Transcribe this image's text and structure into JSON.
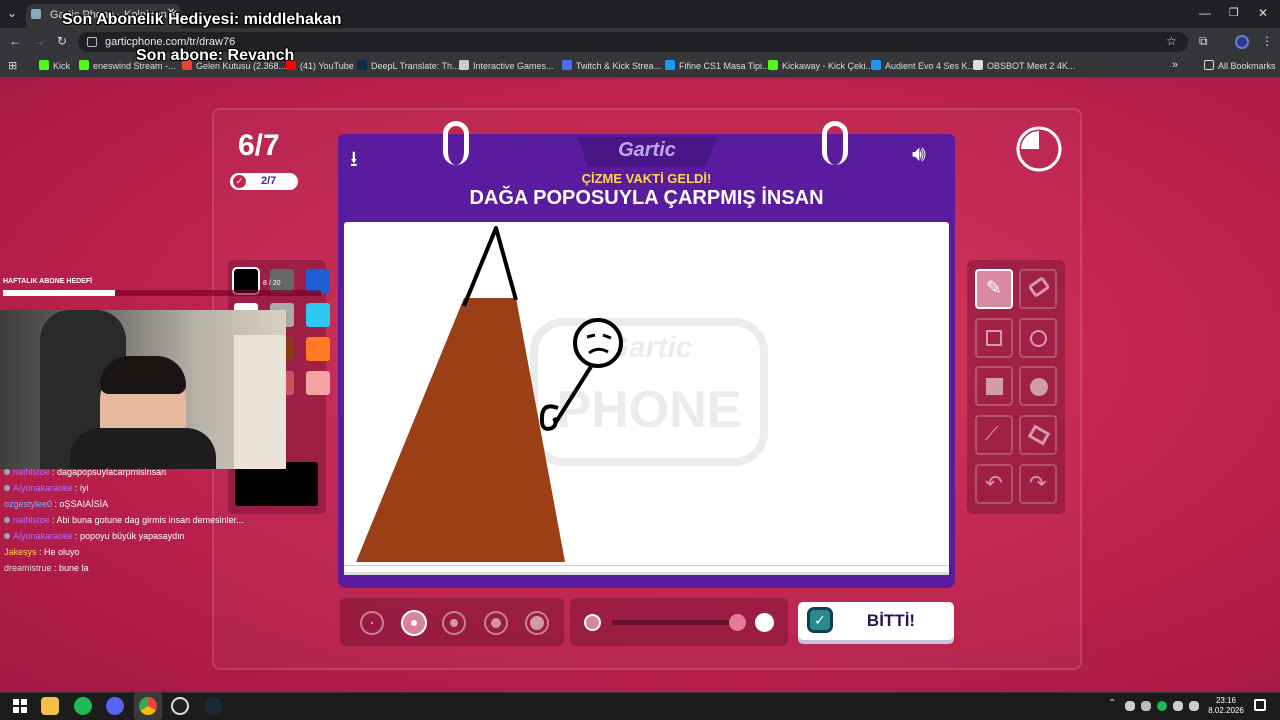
{
  "browser": {
    "tab_title": "Gartic Phone - Kolektan Kulaklı...",
    "url": "garticphone.com/tr/draw76",
    "bookmarks": [
      "Kick",
      "eneswind Stream -...",
      "Gelen Kutusu (2.368...",
      "(41) YouTube",
      "DeepL Translate: Th...",
      "Interactive Games...",
      "Twitch & Kick Strea...",
      "Fifine CS1 Masa Tipi...",
      "Kickaway - Kick Çeki...",
      "Audient Evo 4 Ses K...",
      "OBSBOT Meet 2 4K..."
    ],
    "all_bookmarks": "All Bookmarks"
  },
  "overlay": {
    "sub_gift": "Son Abonelik Hediyesi: middlehakan",
    "last_sub": "Son abone: Revanch",
    "goal_label": "HAFTALIK ABONE HEDEFİ",
    "goal_progress": 0.36,
    "goal_count": "8 / 20"
  },
  "chat": [
    {
      "user": "nathlstoe",
      "message": "dagapopsuylacarpmisinsan",
      "color": "#b36bff"
    },
    {
      "user": "Alyonakaraoke",
      "message": "iyi",
      "color": "#b36bff"
    },
    {
      "user": "ozgestylee0",
      "message": "oŞSAIAİSİA",
      "color": "#7fb0ff"
    },
    {
      "user": "nathlstoe",
      "message": "Abi buna gotune dag girmis insan demesinler...",
      "color": "#b36bff"
    },
    {
      "user": "Alyonakaraoke",
      "message": "popoyu büyük yapasaydın",
      "color": "#b36bff"
    },
    {
      "user": "Jakesys",
      "message": "He oluyo",
      "color": "#ffd24a"
    },
    {
      "user": "dreamistrue",
      "message": "bune la",
      "color": "#dddddd"
    }
  ],
  "game": {
    "round": "6/7",
    "done_count": "2/7",
    "logo": "Gartic",
    "prompt_heading": "ÇİZME VAKTİ GELDİ!",
    "prompt": "DAĞA POPOSUYLA ÇARPMIŞ İNSAN",
    "done_button": "BİTTİ!",
    "timer_remaining": 0.75,
    "watermark": "Gartic PHONE",
    "colors": {
      "brand_purple": "#5a1b9e",
      "header_purple": "#4a1687",
      "accent_yellow": "#ffd84a",
      "mountain_brown": "#9b3f17"
    },
    "palette": [
      "#000000",
      "#666666",
      "#1c5fd6",
      "#ffffff",
      "#aaaaaa",
      "#2ec9f2",
      "#771f0a",
      "#8a3a17",
      "#ff7a22",
      "#c6385a",
      "#d0525e",
      "#f6a3a3"
    ],
    "selected_color": "#000000",
    "tools": [
      "pen-icon",
      "eraser-icon",
      "rectangle-outline-icon",
      "circle-outline-icon",
      "rectangle-fill-icon",
      "circle-fill-icon",
      "line-icon",
      "bucket-icon",
      "undo-icon",
      "redo-icon"
    ]
  },
  "taskbar": {
    "time": "23:16",
    "date": "8.02.2026"
  }
}
